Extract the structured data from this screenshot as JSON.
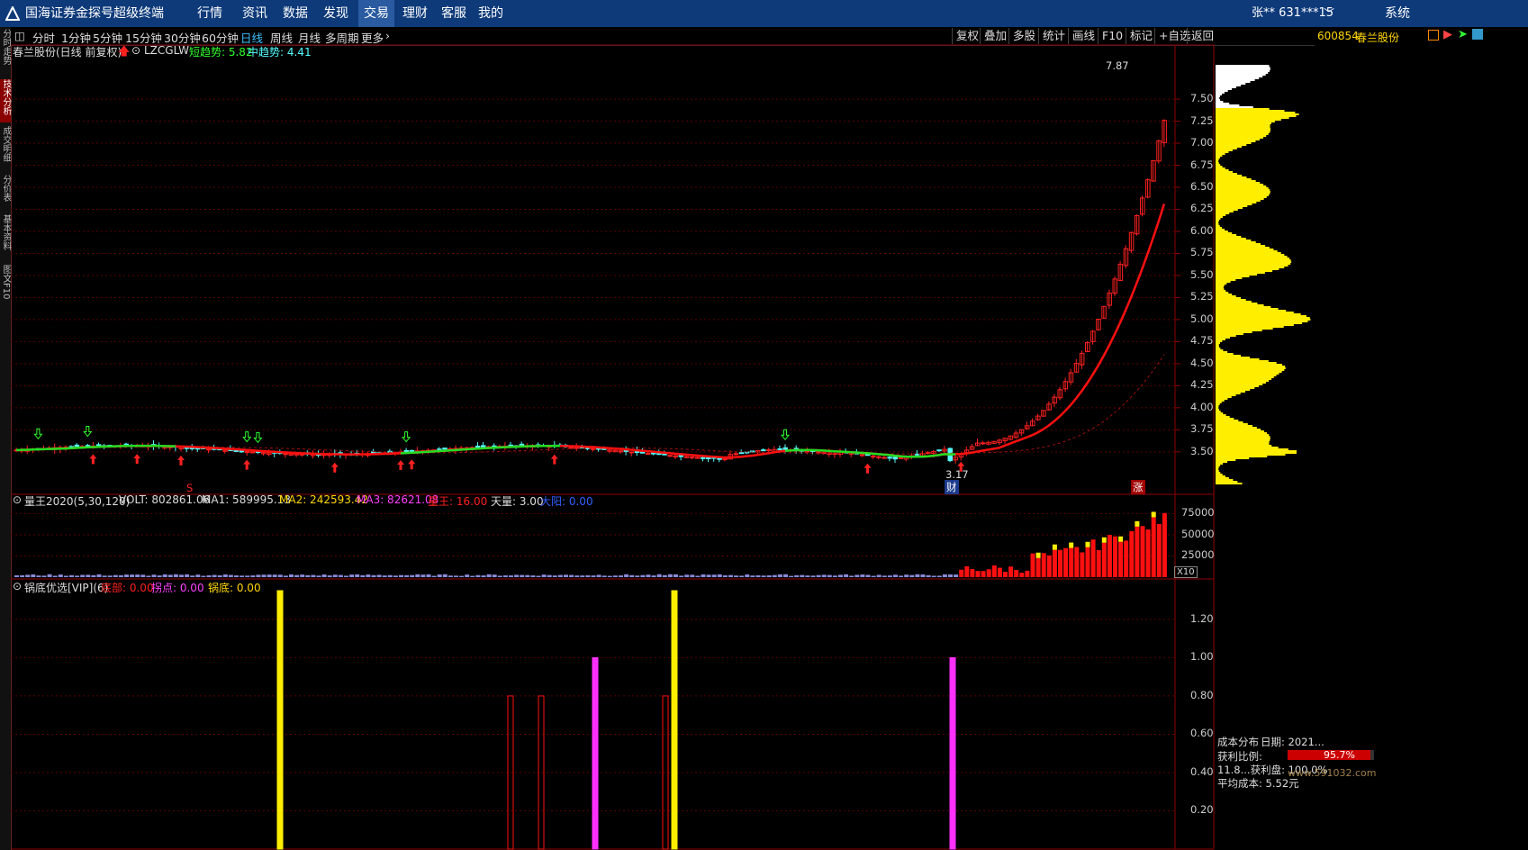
{
  "topbar": {
    "title": "国海证券金探号超级终端",
    "menus": [
      "行情",
      "资讯",
      "数据",
      "发现",
      "交易",
      "理财",
      "客服",
      "我的"
    ],
    "user": "张** 631***15",
    "system": "系统"
  },
  "lefttabs": [
    "分时走势",
    "技术分析",
    "成交明细",
    "分价表",
    "基本资料",
    "图文F10"
  ],
  "periods": [
    "分时",
    "1分钟",
    "5分钟",
    "15分钟",
    "30分钟",
    "60分钟",
    "日线",
    "周线",
    "月线",
    "多周期",
    "更多"
  ],
  "active_period": "日线",
  "tools": [
    "复权",
    "叠加",
    "多股",
    "统计",
    "画线",
    "F10",
    "标记",
    "+自选",
    "返回"
  ],
  "stock": {
    "code": "600854",
    "name": "春兰股份",
    "header": "春兰股份(日线 前复权)",
    "indicator": "LZCGLW",
    "short_trend": "短趋势: 5.82",
    "mid_trend": "中趋势: 4.41"
  },
  "main_chart": {
    "high_label": "7.87",
    "low_label": "3.17",
    "y_ticks": [
      "7.50",
      "7.25",
      "7.00",
      "6.75",
      "6.50",
      "6.25",
      "6.00",
      "5.75",
      "5.50",
      "5.25",
      "5.00",
      "4.75",
      "4.50",
      "4.25",
      "4.00",
      "3.75",
      "3.50"
    ],
    "markers": {
      "cai": "财",
      "zhang": "涨",
      "s": "S"
    }
  },
  "volume_pane": {
    "title": "量王2020(5,30,120)",
    "volt": "VOLT: 802861.06",
    "ma1": "MA1: 589995.13",
    "ma2": "MA2: 242593.42",
    "ma3": "MA3: 82621.08",
    "wang": "量王: 16.00",
    "tian": "天量: 3.00",
    "dayang": "大阳: 0.00",
    "y_ticks": [
      "75000",
      "50000",
      "25000"
    ],
    "unit": "X10"
  },
  "bottom_pane": {
    "title": "锅底优选[VIP](6)",
    "dibu": "底部: 0.00",
    "guaidian": "拐点: 0.00",
    "guodi": "锅底: 0.00",
    "y_ticks": [
      "1.20",
      "1.00",
      "0.80",
      "0.60",
      "0.40",
      "0.20"
    ]
  },
  "chip_panel": {
    "title": "成本分布",
    "date": "日期: 2021...",
    "profit_ratio": "获利比例:",
    "profit_value": "95.7%",
    "profit_line": "11.8...获利盘: 100.0%",
    "avg_cost": "平均成本: 5.52元",
    "watermark": "www.591032.com"
  },
  "colors": {
    "up": "#ff2020",
    "down": "#54ffff",
    "ma_green": "#22dd22",
    "ma_red": "#ff1010",
    "chip_yellow": "#ffee00",
    "grid": "#5a0000",
    "accent_menu": "#0e3a7a"
  }
}
